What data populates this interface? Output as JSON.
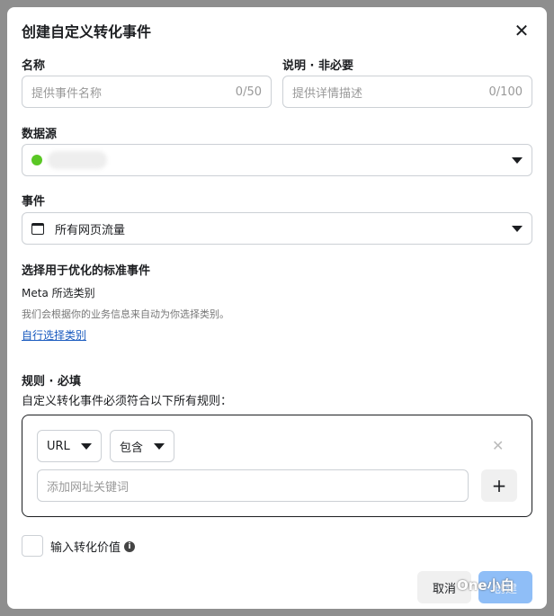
{
  "dialog": {
    "title": "创建自定义转化事件",
    "name_label": "名称",
    "name_placeholder": "提供事件名称",
    "name_counter": "0/50",
    "desc_label": "说明 · 非必要",
    "desc_placeholder": "提供详情描述",
    "desc_counter": "0/100",
    "source_label": "数据源",
    "source_status_color": "#5ac725",
    "event_label": "事件",
    "event_value": "所有网页流量",
    "standard_label": "选择用于优化的标准事件",
    "meta_category": "Meta 所选类别",
    "meta_hint": "我们会根据你的业务信息来自动为你选择类别。",
    "custom_category_link": "自行选择类别",
    "rules_label": "规则 · 必填",
    "rules_hint": "自定义转化事件必须符合以下所有规则：",
    "rule_field": "URL",
    "rule_operator": "包含",
    "keyword_placeholder": "添加网址关键词",
    "value_label": "输入转化价值",
    "cancel": "取消",
    "create": "创建"
  },
  "watermark": "One小白"
}
